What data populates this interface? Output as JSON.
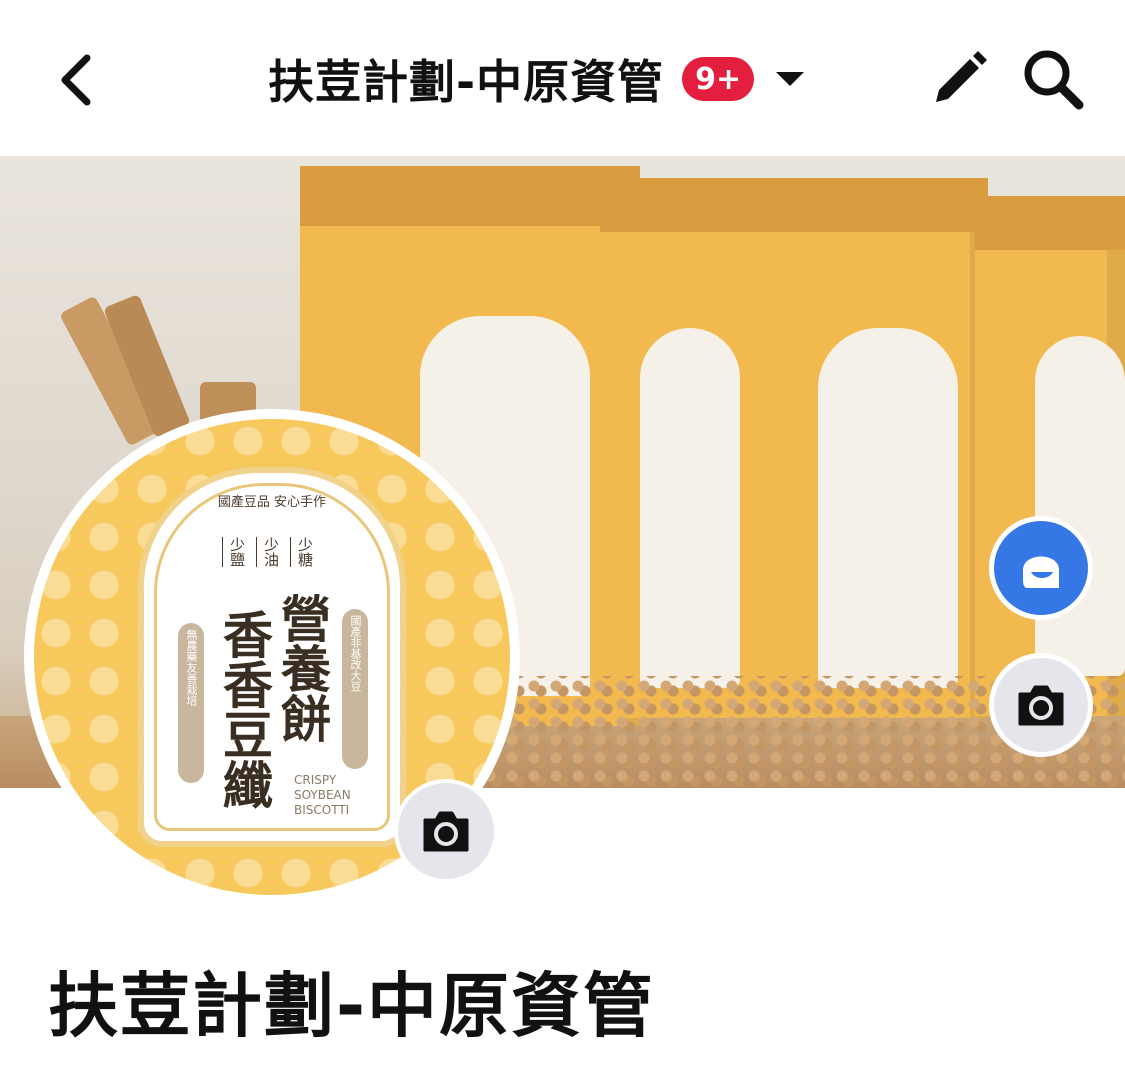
{
  "header": {
    "title": "扶荳計劃-中原資管",
    "notification_badge": "9+",
    "back_icon": "chevron-left-icon",
    "dropdown_icon": "caret-down-icon",
    "edit_icon": "pencil-icon",
    "search_icon": "search-icon"
  },
  "cover_photo": {
    "camera_icon": "camera-icon",
    "avatar_icon": "avatar-icon"
  },
  "profile_picture": {
    "tagline": "國產豆品 安心手作",
    "features": [
      "少鹽",
      "少油",
      "少糖"
    ],
    "product_name_left": "香香豆纖",
    "product_name_right": "營養餅",
    "side_left": "無農藥友善栽培",
    "side_right": "國產非基改大豆",
    "english_name": [
      "CRISPY",
      "SOYBEAN",
      "BISCOTTI"
    ],
    "camera_icon": "camera-icon"
  },
  "page": {
    "name": "扶荳計劃-中原資管"
  },
  "colors": {
    "badge": "#e41e3f",
    "avatar_button": "#3578e5",
    "camera_button": "#e4e6eb",
    "product_yellow": "#f7c95c"
  }
}
